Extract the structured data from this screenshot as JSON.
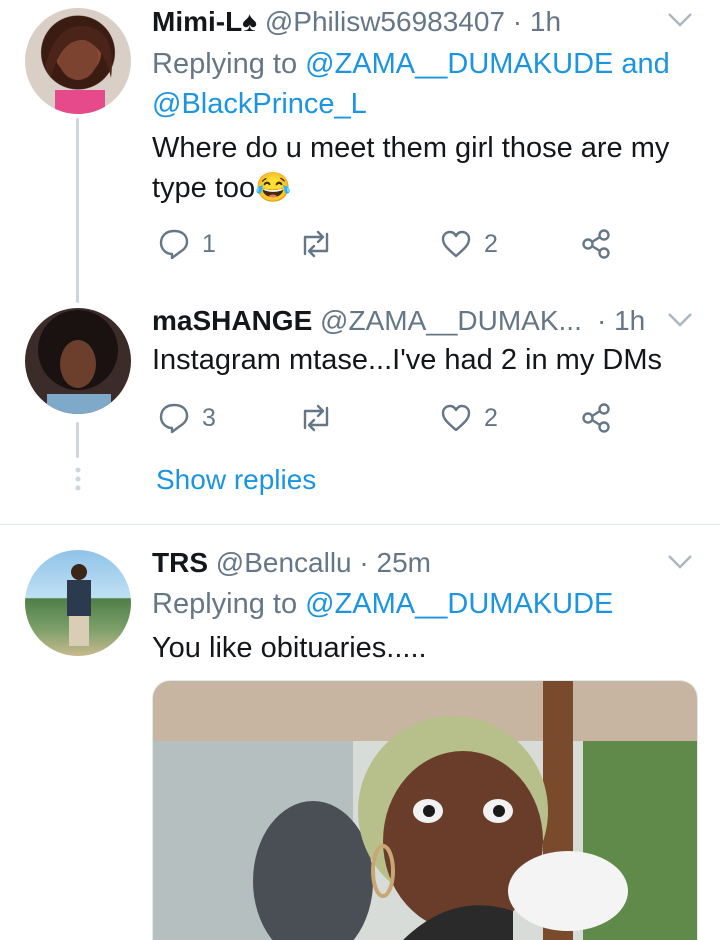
{
  "tweets": [
    {
      "name": "Mimi-L♠",
      "handle": "@Philisw56983407",
      "time": "· 1h",
      "replying_prefix": "Replying to",
      "replying_to_1": "@ZAMA__DUMAKUDE and",
      "replying_to_2": "@BlackPrince_L",
      "text_line1": "Where do u meet them girl those are my",
      "text_line2": "type too😂",
      "reply_count": "1",
      "like_count": "2"
    },
    {
      "name": "maSHANGE",
      "handle": "@ZAMA__DUMAK...",
      "time": "· 1h",
      "text_line1": "Instagram mtase...I've had 2 in my DMs",
      "reply_count": "3",
      "like_count": "2",
      "show_replies": "Show replies"
    },
    {
      "name": "TRS",
      "handle": "@Bencallu",
      "time": "· 25m",
      "replying_prefix": "Replying to",
      "replying_to_1": "@ZAMA__DUMAKUDE",
      "text_line1": "You like obituaries....."
    }
  ],
  "colors": {
    "link": "#1b95e0",
    "secondary": "#657786",
    "thread_line": "#ccd6dd"
  }
}
